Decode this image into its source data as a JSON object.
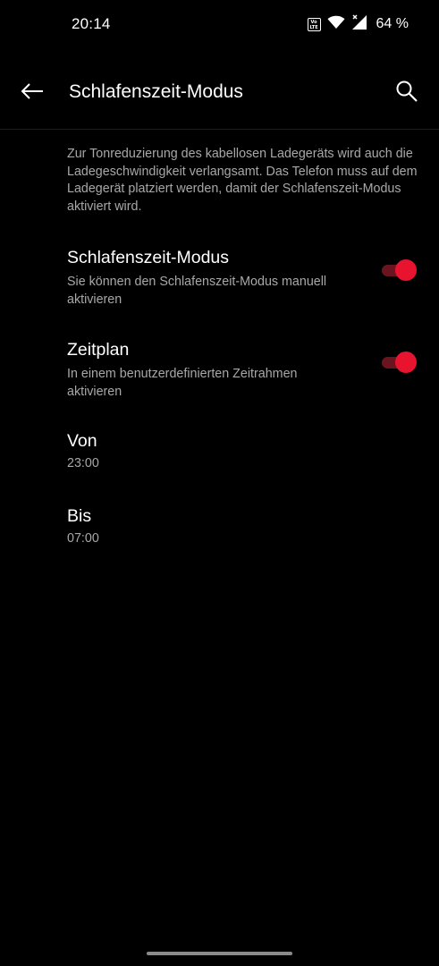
{
  "status_bar": {
    "time": "20:14",
    "volte_label": "Vo\nLTE",
    "battery": "64 %",
    "icons": [
      "volte-icon",
      "wifi-icon",
      "signal-no-service-icon"
    ]
  },
  "app_bar": {
    "title": "Schlafenszeit-Modus",
    "back_icon": "arrow-left-icon",
    "search_icon": "search-icon"
  },
  "description": "Zur Tonreduzierung des kabellosen Ladegeräts wird auch die Ladegeschwindigkeit verlangsamt. Das Telefon muss auf dem Ladegerät platziert werden, damit der Schlafenszeit-Modus aktiviert wird.",
  "settings": [
    {
      "title": "Schlafenszeit-Modus",
      "summary": "Sie können den Schlafenszeit-Modus manuell aktivieren",
      "enabled": true
    },
    {
      "title": "Zeitplan",
      "summary": "In einem benutzerdefinierten Zeitrahmen aktivieren",
      "enabled": true
    }
  ],
  "schedule": {
    "from_label": "Von",
    "from_value": "23:00",
    "to_label": "Bis",
    "to_value": "07:00"
  },
  "colors": {
    "background": "#000000",
    "accent": "#e8142f",
    "accent_track": "#6a1420",
    "secondary_text": "#a8a8a8"
  }
}
